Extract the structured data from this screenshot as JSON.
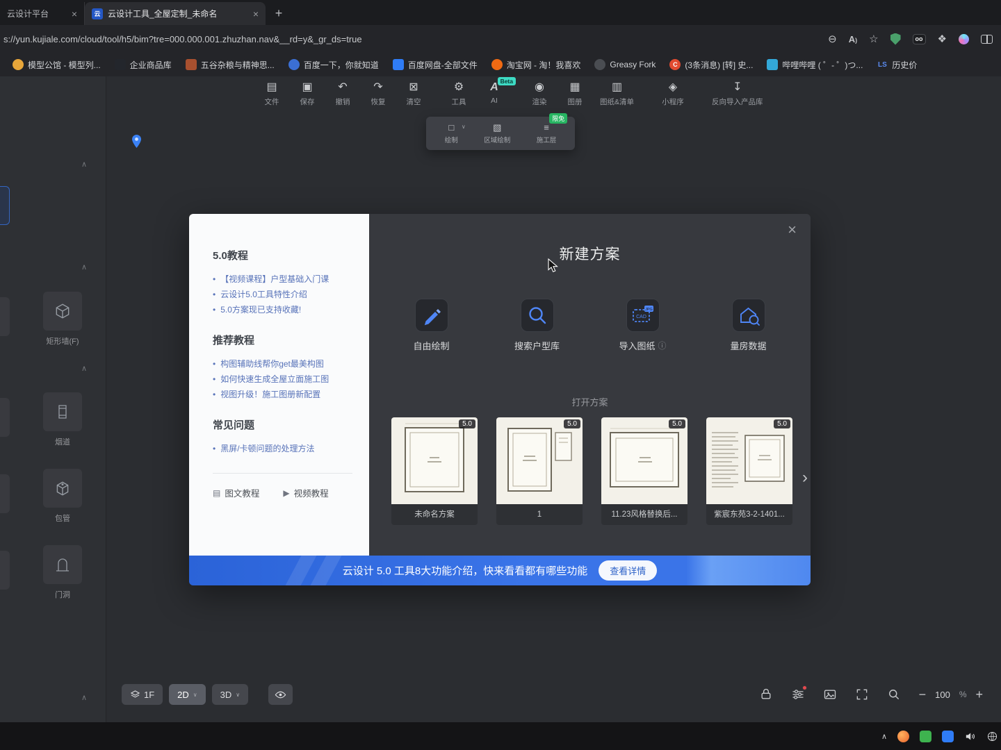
{
  "browser": {
    "tabs": [
      {
        "title": "云设计平台"
      },
      {
        "title": "云设计工具_全屋定制_未命名"
      }
    ],
    "new_tab_label": "+",
    "url": "s://yun.kujiale.com/cloud/tool/h5/bim?tre=000.000.001.zhuzhan.nav&__rd=y&_gr_ds=true",
    "bookmarks": [
      {
        "label": "模型公馆 - 模型列...",
        "color": "#e7a63a",
        "glyph": ""
      },
      {
        "label": "企业商品库",
        "color": "#23262c",
        "glyph": ""
      },
      {
        "label": "五谷杂粮与精神思...",
        "color": "#a8502f",
        "glyph": ""
      },
      {
        "label": "百度一下，你就知道",
        "color": "#3b6fd4",
        "glyph": ""
      },
      {
        "label": "百度网盘-全部文件",
        "color": "#2f7cf6",
        "glyph": ""
      },
      {
        "label": "淘宝网 - 淘！我喜欢",
        "color": "#f06a13",
        "glyph": ""
      },
      {
        "label": "Greasy Fork",
        "color": "#4a4d52",
        "glyph": ""
      },
      {
        "label": "(3条消息) [转] 史...",
        "color": "#e24b30",
        "glyph": "C"
      },
      {
        "label": "哔哩哔哩 ( ゜- ゜)つ...",
        "color": "#33a8d8",
        "glyph": ""
      },
      {
        "label": "历史价",
        "color": "#3a66d1",
        "glyph": "LS"
      }
    ]
  },
  "toolbar": {
    "items": [
      {
        "label": "文件",
        "icon": "file-icon"
      },
      {
        "label": "保存",
        "icon": "save-icon"
      },
      {
        "label": "撤销",
        "icon": "undo-icon"
      },
      {
        "label": "恢复",
        "icon": "redo-icon"
      },
      {
        "label": "清空",
        "icon": "clear-icon"
      },
      {
        "label": "工具",
        "icon": "tools-icon"
      },
      {
        "label": "AI",
        "icon": "ai-icon",
        "badge": "Beta"
      },
      {
        "label": "渲染",
        "icon": "render-icon"
      },
      {
        "label": "图册",
        "icon": "album-icon"
      },
      {
        "label": "图纸&清单",
        "icon": "sheets-icon"
      },
      {
        "label": "小程序",
        "icon": "miniapp-icon"
      },
      {
        "label": "反向导入产品库",
        "icon": "import-icon"
      }
    ]
  },
  "sub_toolbar": {
    "items": [
      {
        "label": "绘制",
        "icon": "draw-icon"
      },
      {
        "label": "区域绘制",
        "icon": "region-draw-icon"
      },
      {
        "label": "施工层",
        "icon": "construction-layer-icon",
        "badge": "限免"
      }
    ]
  },
  "catalog": {
    "items": [
      {
        "label": "矩形墙(F)"
      },
      {
        "label": "烟道"
      },
      {
        "label": "包管"
      },
      {
        "label": "门洞"
      }
    ]
  },
  "dialog": {
    "title": "新建方案",
    "close": "×",
    "tutorial": {
      "s1_title": "5.0教程",
      "s1_links": [
        "【视频课程】户型基础入门课",
        "云设计5.0工具特性介绍",
        "5.0方案现已支持收藏!"
      ],
      "s2_title": "推荐教程",
      "s2_links": [
        "构图辅助线帮你get最美构图",
        "如何快速生成全屋立面施工图",
        "视图升级！施工图册新配置"
      ],
      "s3_title": "常见问题",
      "s3_links": [
        "黑屏/卡顿问题的处理方法"
      ],
      "footer_doc": "图文教程",
      "footer_video": "视频教程"
    },
    "create_options": [
      {
        "label": "自由绘制",
        "icon": "pencil-icon"
      },
      {
        "label": "搜索户型库",
        "icon": "search-icon"
      },
      {
        "label": "导入图纸",
        "icon": "import-cad-icon",
        "info": "ⓘ"
      },
      {
        "label": "量房数据",
        "icon": "house-measure-icon"
      }
    ],
    "open_title": "打开方案",
    "plans": [
      {
        "name": "未命名方案",
        "badge": "5.0"
      },
      {
        "name": "1",
        "badge": "5.0"
      },
      {
        "name": "11.23风格替换后...",
        "badge": "5.0"
      },
      {
        "name": "紫宸东苑3-2-1401...",
        "badge": "5.0"
      }
    ]
  },
  "banner": {
    "text": "云设计 5.0 工具8大功能介绍，快来看看都有哪些功能",
    "button": "查看详情"
  },
  "bottom_bar": {
    "floor": "1F",
    "mode_2d": "2D",
    "mode_3d": "3D",
    "zoom_value": "100",
    "zoom_unit": "%"
  },
  "colors": {
    "accent_blue": "#4f86f7",
    "banner_blue": "#3a74e8",
    "badge_green": "#27b562",
    "beta_teal": "#3ddbc4",
    "adguard_green": "#4aa06b"
  }
}
